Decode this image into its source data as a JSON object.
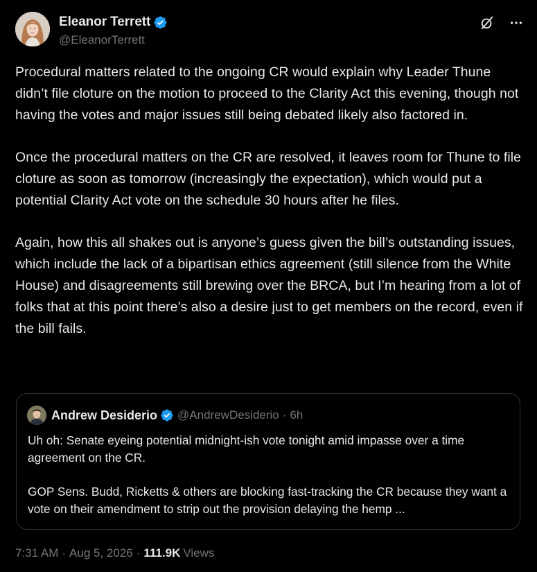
{
  "colors": {
    "background": "#000000",
    "text_primary": "#e7e9ea",
    "text_secondary": "#71767b",
    "verified_badge": "#1d9bf0",
    "border": "#2f3336"
  },
  "tweet": {
    "author": {
      "display_name": "Eleanor Terrett",
      "handle": "@EleanorTerrett",
      "verified": true,
      "avatar_icon": "profile-photo"
    },
    "actions": {
      "grok_icon": "grok-icon",
      "more_icon": "more-icon"
    },
    "paragraphs": [
      "Procedural matters related to the ongoing CR would explain why Leader Thune didn’t file cloture on the motion to proceed to the Clarity Act this evening, though not having the votes and major issues still being debated likely also factored in.",
      "Once the procedural matters on the CR are resolved, it leaves room for Thune to file cloture as soon as tomorrow (increasingly the expectation), which would put a potential Clarity Act vote on the schedule 30 hours after he files.",
      "Again, how this all shakes out is anyone’s guess given the bill’s outstanding issues, which include the lack of a bipartisan ethics agreement (still silence from the White House) and disagreements still brewing over the BRCA, but I’m hearing from a lot of folks that at this point there’s also a desire just to get members on the record, even if the bill fails."
    ],
    "quoted_tweet": {
      "display_name": "Andrew Desiderio",
      "handle": "@AndrewDesiderio",
      "separator": "·",
      "time": "6h",
      "verified": true,
      "paragraphs": [
        "Uh oh: Senate eyeing potential midnight-ish vote tonight amid impasse over a time agreement on the CR.",
        "GOP Sens. Budd, Ricketts & others are blocking fast-tracking the CR because they want a vote on their amendment to strip out the provision delaying the hemp ..."
      ]
    },
    "meta": {
      "time": "7:31 AM",
      "sep1": "·",
      "date": "Aug 5, 2026",
      "sep2": "·",
      "views_count": "111.9K",
      "views_label": "Views"
    }
  }
}
